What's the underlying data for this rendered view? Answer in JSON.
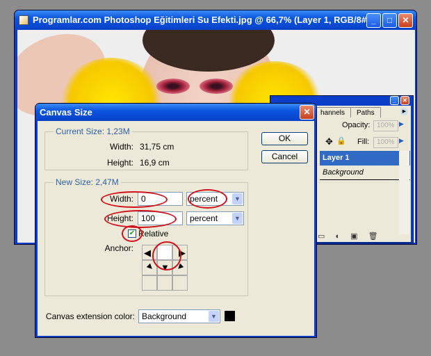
{
  "window": {
    "title": "Programlar.com Photoshop Eğitimleri Su Efekti.jpg @ 66,7% (Layer 1, RGB/8#)",
    "minimize": "_",
    "maximize": "□",
    "close": "✕"
  },
  "layers_panel": {
    "tabs": [
      {
        "label": "hannels"
      },
      {
        "label": "Paths"
      }
    ],
    "opacity_label": "Opacity:",
    "opacity_value": "100%",
    "fill_label": "Fill:",
    "fill_value": "100%",
    "layers": [
      {
        "name": "Layer 1",
        "selected": true
      },
      {
        "name": "Background",
        "locked": true
      }
    ],
    "accent": "#316ac5"
  },
  "dialog": {
    "title": "Canvas Size",
    "current_size": {
      "legend": "Current Size: 1,23M",
      "width_label": "Width:",
      "width_value": "31,75 cm",
      "height_label": "Height:",
      "height_value": "16,9 cm"
    },
    "new_size": {
      "legend": "New Size: 2,47M",
      "width_label": "Width:",
      "width_value": "0",
      "width_unit": "percent",
      "height_label": "Height:",
      "height_value": "100",
      "height_unit": "percent",
      "relative_label": "Relative",
      "relative_checked": true,
      "anchor_label": "Anchor:"
    },
    "extension_color_label": "Canvas extension color:",
    "extension_color_value": "Background",
    "extension_swatch": "#000000",
    "ok": "OK",
    "cancel": "Cancel",
    "highlight_color": "#d0101a"
  }
}
